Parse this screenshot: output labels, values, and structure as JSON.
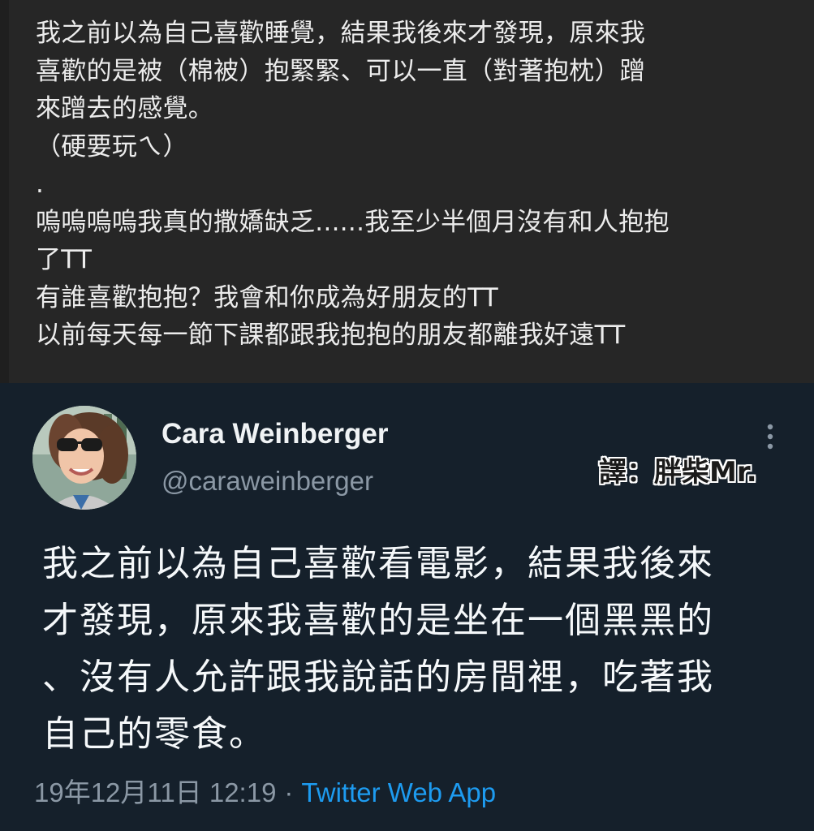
{
  "top_post": {
    "lines": [
      "我之前以為自己喜歡睡覺，結果我後來才發現，原來我",
      "喜歡的是被（棉被）抱緊緊、可以一直（對著抱枕）蹭",
      "來蹭去的感覺。",
      "（硬要玩ㄟ）",
      ".",
      "嗚嗚嗚嗚我真的撒嬌缺乏......我至少半個月沒有和人抱抱",
      "了TT",
      "有誰喜歡抱抱？我會和你成為好朋友的TT",
      "以前每天每一節下課都跟我抱抱的朋友都離我好遠TT"
    ]
  },
  "tweet": {
    "display_name": "Cara Weinberger",
    "handle": "@caraweinberger",
    "avatar_icon": "profile-photo",
    "more_icon": "more-vertical-icon",
    "watermark": "譯：胖柴Mr.",
    "text_lines": [
      "我之前以為自己喜歡看電影，結果我後來",
      "才發現，原來我喜歡的是坐在一個黑黑的",
      "、沒有人允許跟我說話的房間裡，吃著我",
      "自己的零食。"
    ],
    "timestamp": "19年12月11日 12:19",
    "separator": "·",
    "source": "Twitter Web App"
  },
  "colors": {
    "top_post_bg": "#262626",
    "tweet_bg": "#15202b",
    "link": "#1d9bf0",
    "secondary_text": "#8b98a5"
  }
}
